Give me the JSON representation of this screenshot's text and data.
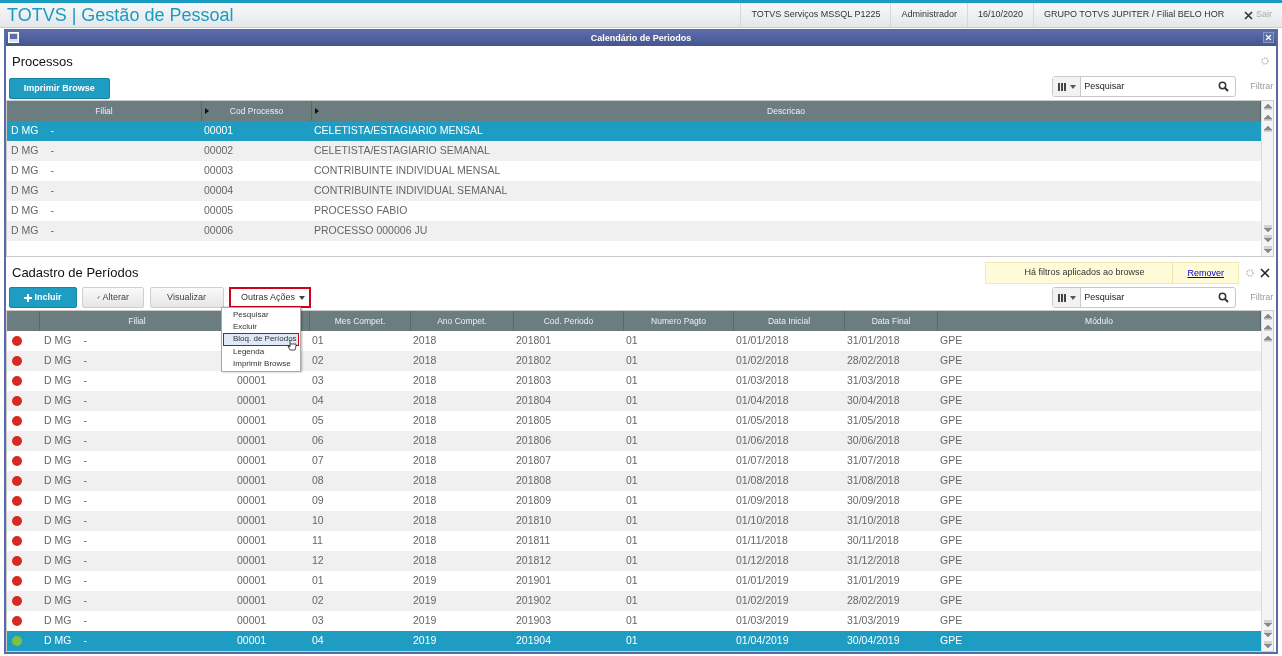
{
  "app_header": {
    "title": "TOTVS | Gestão de Pessoal",
    "environment": "TOTVS Serviços MSSQL P1225",
    "user": "Administrador",
    "date": "16/10/2020",
    "company": "GRUPO TOTVS JUPITER / Filial BELO HOR",
    "exit_label": "Sair"
  },
  "window": {
    "title": "Calendário de Periodos"
  },
  "processos": {
    "title": "Processos",
    "print_button": "Imprimir Browse",
    "search": {
      "placeholder": "Pesquisar"
    },
    "filter_label": "Filtrar",
    "columns": [
      {
        "label": "Filial"
      },
      {
        "label": "Cod Processo"
      },
      {
        "label": "Descricao"
      }
    ],
    "rows": [
      {
        "filial": "D MG",
        "filial_2": "-",
        "cod": "00001",
        "descricao": "CELETISTA/ESTAGIARIO MENSAL",
        "selected": true
      },
      {
        "filial": "D MG",
        "filial_2": "-",
        "cod": "00002",
        "descricao": "CELETISTA/ESTAGIARIO SEMANAL",
        "selected": false
      },
      {
        "filial": "D MG",
        "filial_2": "-",
        "cod": "00003",
        "descricao": "CONTRIBUINTE INDIVIDUAL MENSAL",
        "selected": false
      },
      {
        "filial": "D MG",
        "filial_2": "-",
        "cod": "00004",
        "descricao": "CONTRIBUINTE INDIVIDUAL SEMANAL",
        "selected": false
      },
      {
        "filial": "D MG",
        "filial_2": "-",
        "cod": "00005",
        "descricao": "PROCESSO FABIO",
        "selected": false
      },
      {
        "filial": "D MG",
        "filial_2": "-",
        "cod": "00006",
        "descricao": "PROCESSO 000006 JU",
        "selected": false
      }
    ]
  },
  "cadastro": {
    "title": "Cadastro de Períodos",
    "filter_notice": "Há filtros aplicados ao browse",
    "remove_link": "Remover",
    "buttons": [
      {
        "label": "Incluir",
        "kind": "primary"
      },
      {
        "label": "Alterar",
        "kind": "edit"
      },
      {
        "label": "Visualizar",
        "kind": "plain"
      }
    ],
    "more_actions": {
      "label": "Outras Ações",
      "expanded": true,
      "items": [
        {
          "label": "Pesquisar",
          "selected": false
        },
        {
          "label": "Excluir",
          "selected": false
        },
        {
          "label": "Bloq. de Períodos",
          "selected": true
        },
        {
          "label": "Legenda",
          "selected": false
        },
        {
          "label": "Imprimir Browse",
          "selected": false
        }
      ]
    },
    "search": {
      "placeholder": "Pesquisar"
    },
    "filter_label": "Filtrar",
    "columns": [
      {},
      {
        "label": "Filial"
      },
      {},
      {
        "label": "Mes Compet."
      },
      {
        "label": "Ano Compet."
      },
      {
        "label": "Cod. Periodo"
      },
      {
        "label": "Numero Pagto"
      },
      {
        "label": "Data Inicial"
      },
      {
        "label": "Data Final"
      },
      {
        "label": "Módulo"
      }
    ],
    "rows": [
      {
        "color": "#d42a22",
        "filial": "D MG",
        "filial_2": "-",
        "mes": "01",
        "ano": "2018",
        "periodo": "201801",
        "pagto": "01",
        "inicio": "01/01/2018",
        "fim": "31/01/2018",
        "modulo": "GPE",
        "selected": false
      },
      {
        "color": "#d42a22",
        "filial": "D MG",
        "filial_2": "-",
        "mes": "02",
        "ano": "2018",
        "periodo": "201802",
        "pagto": "01",
        "inicio": "01/02/2018",
        "fim": "28/02/2018",
        "modulo": "GPE",
        "selected": false
      },
      {
        "color": "#d42a22",
        "filial": "D MG",
        "filial_2": "-",
        "cod": "00001",
        "mes": "03",
        "ano": "2018",
        "periodo": "201803",
        "pagto": "01",
        "inicio": "01/03/2018",
        "fim": "31/03/2018",
        "modulo": "GPE",
        "selected": false
      },
      {
        "color": "#d42a22",
        "filial": "D MG",
        "filial_2": "-",
        "cod": "00001",
        "mes": "04",
        "ano": "2018",
        "periodo": "201804",
        "pagto": "01",
        "inicio": "01/04/2018",
        "fim": "30/04/2018",
        "modulo": "GPE",
        "selected": false
      },
      {
        "color": "#d42a22",
        "filial": "D MG",
        "filial_2": "-",
        "cod": "00001",
        "mes": "05",
        "ano": "2018",
        "periodo": "201805",
        "pagto": "01",
        "inicio": "01/05/2018",
        "fim": "31/05/2018",
        "modulo": "GPE",
        "selected": false
      },
      {
        "color": "#d42a22",
        "filial": "D MG",
        "filial_2": "-",
        "cod": "00001",
        "mes": "06",
        "ano": "2018",
        "periodo": "201806",
        "pagto": "01",
        "inicio": "01/06/2018",
        "fim": "30/06/2018",
        "modulo": "GPE",
        "selected": false
      },
      {
        "color": "#d42a22",
        "filial": "D MG",
        "filial_2": "-",
        "cod": "00001",
        "mes": "07",
        "ano": "2018",
        "periodo": "201807",
        "pagto": "01",
        "inicio": "01/07/2018",
        "fim": "31/07/2018",
        "modulo": "GPE",
        "selected": false
      },
      {
        "color": "#d42a22",
        "filial": "D MG",
        "filial_2": "-",
        "cod": "00001",
        "mes": "08",
        "ano": "2018",
        "periodo": "201808",
        "pagto": "01",
        "inicio": "01/08/2018",
        "fim": "31/08/2018",
        "modulo": "GPE",
        "selected": false
      },
      {
        "color": "#d42a22",
        "filial": "D MG",
        "filial_2": "-",
        "cod": "00001",
        "mes": "09",
        "ano": "2018",
        "periodo": "201809",
        "pagto": "01",
        "inicio": "01/09/2018",
        "fim": "30/09/2018",
        "modulo": "GPE",
        "selected": false
      },
      {
        "color": "#d42a22",
        "filial": "D MG",
        "filial_2": "-",
        "cod": "00001",
        "mes": "10",
        "ano": "2018",
        "periodo": "201810",
        "pagto": "01",
        "inicio": "01/10/2018",
        "fim": "31/10/2018",
        "modulo": "GPE",
        "selected": false
      },
      {
        "color": "#d42a22",
        "filial": "D MG",
        "filial_2": "-",
        "cod": "00001",
        "mes": "11",
        "ano": "2018",
        "periodo": "201811",
        "pagto": "01",
        "inicio": "01/11/2018",
        "fim": "30/11/2018",
        "modulo": "GPE",
        "selected": false
      },
      {
        "color": "#d42a22",
        "filial": "D MG",
        "filial_2": "-",
        "cod": "00001",
        "mes": "12",
        "ano": "2018",
        "periodo": "201812",
        "pagto": "01",
        "inicio": "01/12/2018",
        "fim": "31/12/2018",
        "modulo": "GPE",
        "selected": false
      },
      {
        "color": "#d42a22",
        "filial": "D MG",
        "filial_2": "-",
        "cod": "00001",
        "mes": "01",
        "ano": "2019",
        "periodo": "201901",
        "pagto": "01",
        "inicio": "01/01/2019",
        "fim": "31/01/2019",
        "modulo": "GPE",
        "selected": false
      },
      {
        "color": "#d42a22",
        "filial": "D MG",
        "filial_2": "-",
        "cod": "00001",
        "mes": "02",
        "ano": "2019",
        "periodo": "201902",
        "pagto": "01",
        "inicio": "01/02/2019",
        "fim": "28/02/2019",
        "modulo": "GPE",
        "selected": false
      },
      {
        "color": "#d42a22",
        "filial": "D MG",
        "filial_2": "-",
        "cod": "00001",
        "mes": "03",
        "ano": "2019",
        "periodo": "201903",
        "pagto": "01",
        "inicio": "01/03/2019",
        "fim": "31/03/2019",
        "modulo": "GPE",
        "selected": false
      },
      {
        "color": "#7cc242",
        "filial": "D MG",
        "filial_2": "-",
        "cod": "00001",
        "mes": "04",
        "ano": "2019",
        "periodo": "201904",
        "pagto": "01",
        "inicio": "01/04/2019",
        "fim": "30/04/2019",
        "modulo": "GPE",
        "selected": true
      }
    ]
  }
}
